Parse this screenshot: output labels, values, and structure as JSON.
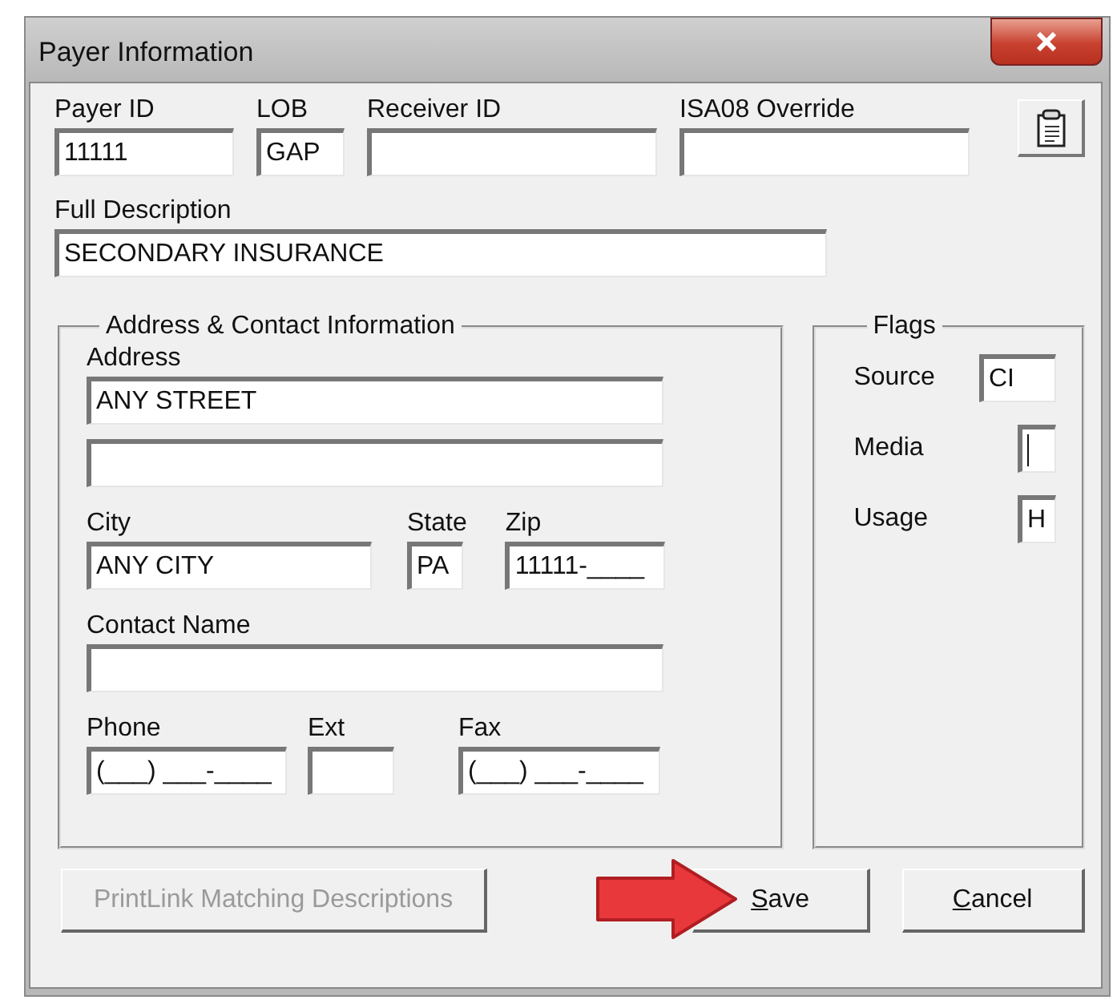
{
  "window": {
    "title": "Payer Information"
  },
  "top_fields": [
    {
      "label": "Payer ID",
      "value": "11111"
    },
    {
      "label": "LOB",
      "value": "GAP"
    },
    {
      "label": "Receiver ID"
    },
    {
      "label": "ISA08 Override"
    }
  ],
  "full_description": {
    "label": "Full Description",
    "value": "SECONDARY INSURANCE"
  },
  "address_group": {
    "title": "Address & Contact Information",
    "address": {
      "label": "Address",
      "line_1": "ANY STREET"
    },
    "city": {
      "label": "City",
      "value": "ANY CITY"
    },
    "state": {
      "label": "State",
      "value": "PA"
    },
    "zip": {
      "label": "Zip",
      "value": "11111-____"
    },
    "contact_name": {
      "label": "Contact Name"
    },
    "phone": {
      "label": "Phone",
      "value": "(___) ___-____"
    },
    "ext": {
      "label": "Ext"
    },
    "fax": {
      "label": "Fax",
      "value": "(___) ___-____"
    }
  },
  "flags": {
    "title": "Flags",
    "items": [
      {
        "label": "Source",
        "value": "CI",
        "focused": false
      },
      {
        "label": "Media",
        "focused": true
      },
      {
        "label": "Usage",
        "value": "H",
        "focused": false
      }
    ]
  },
  "buttons": [
    {
      "text": "PrintLink Matching Descriptions",
      "disabled": true
    },
    {
      "key": "S",
      "text": "ave",
      "disabled": false
    },
    {
      "key": "C",
      "text": "ancel",
      "disabled": false
    }
  ]
}
